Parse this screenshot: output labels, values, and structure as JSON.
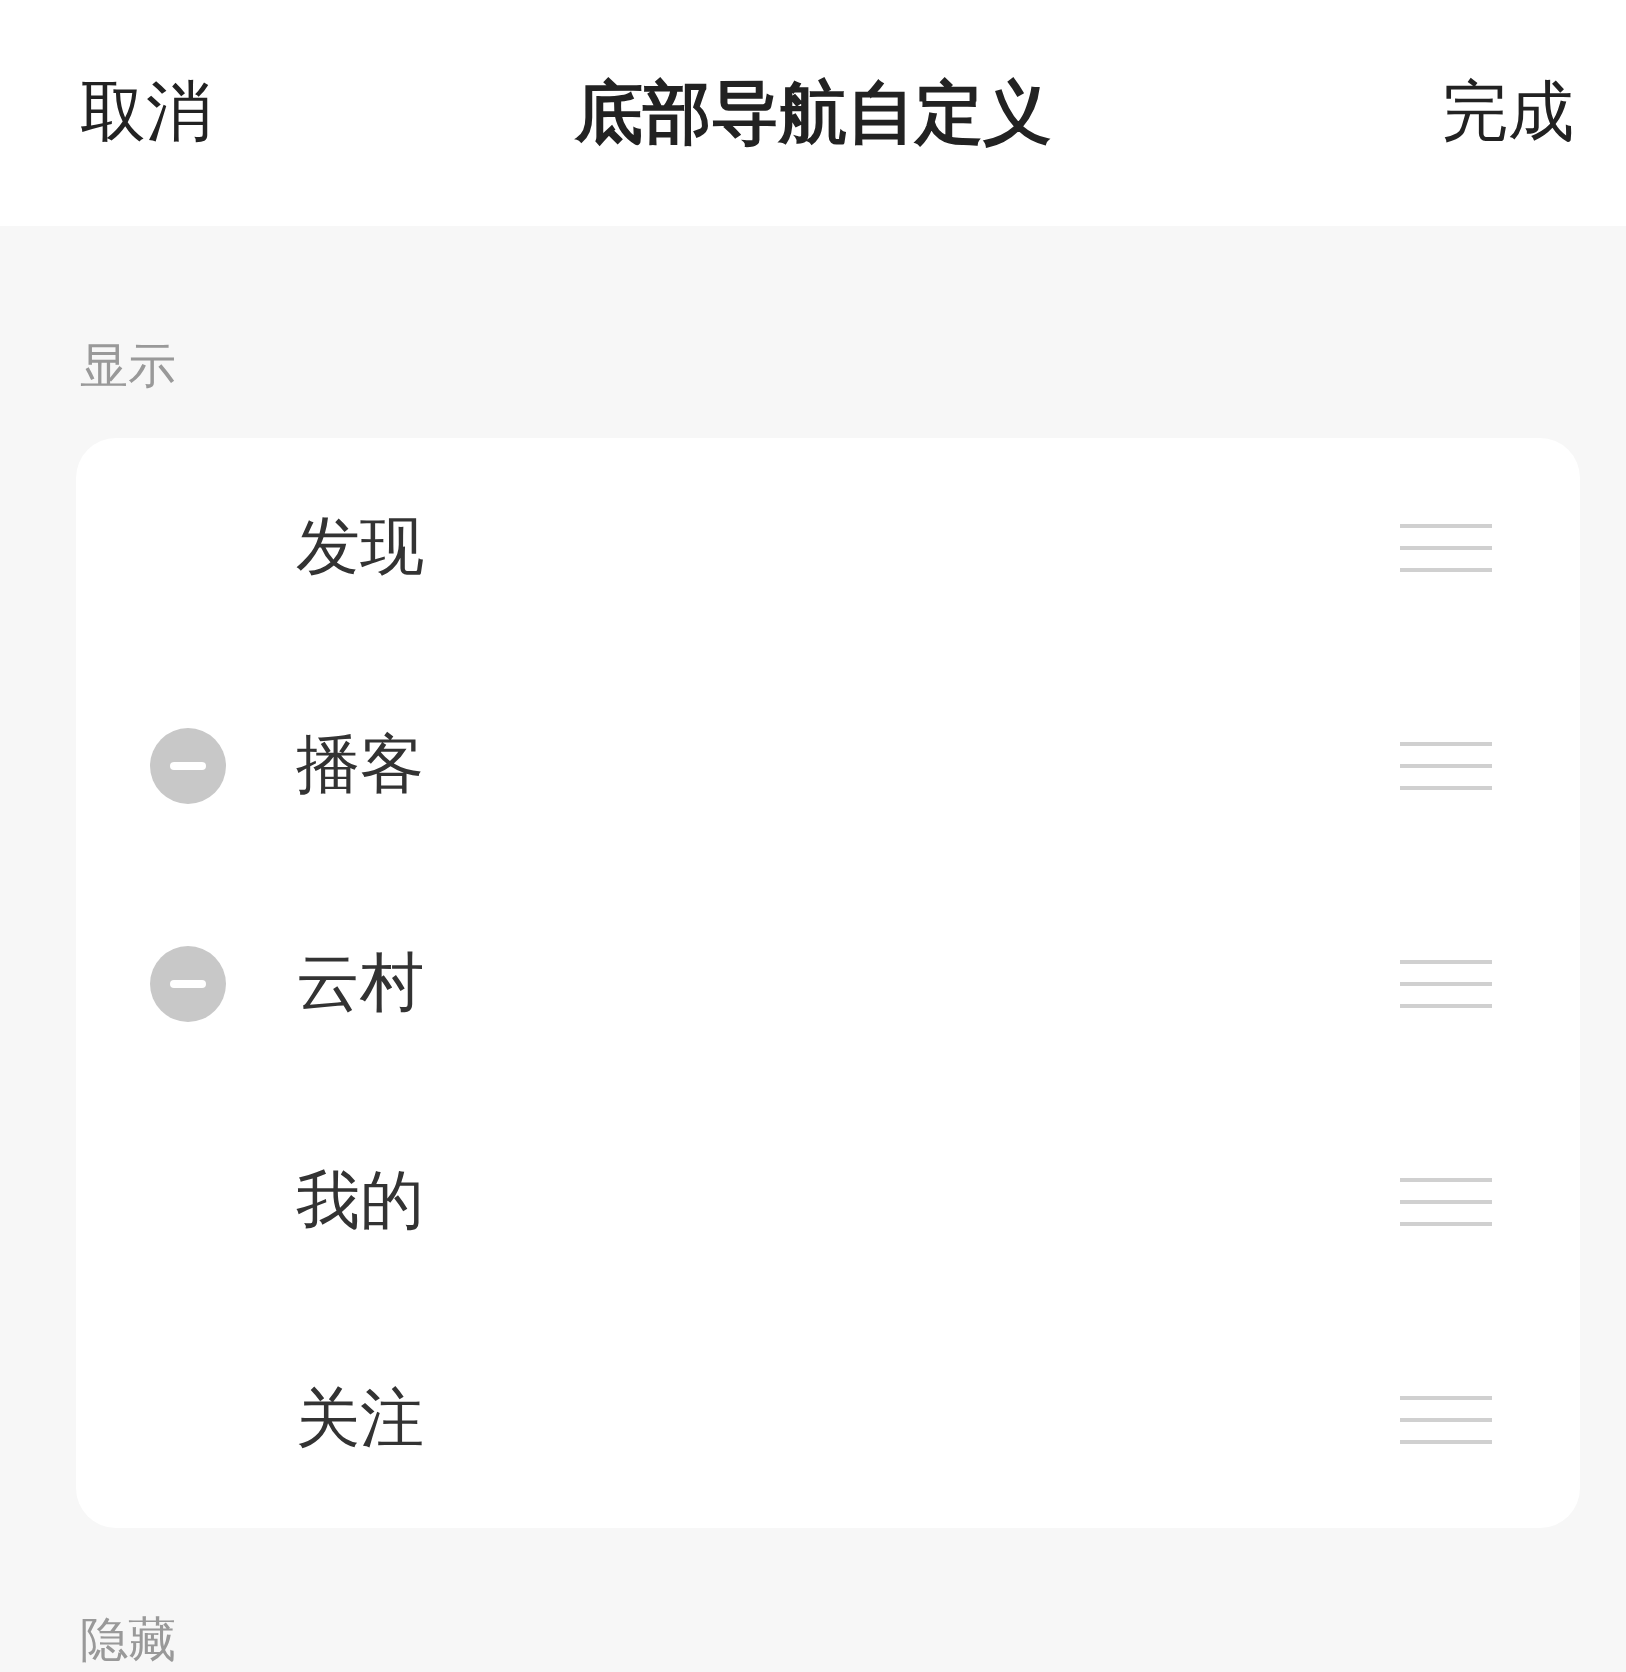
{
  "header": {
    "cancel": "取消",
    "title": "底部导航自定义",
    "done": "完成"
  },
  "shown_section": {
    "label": "显示",
    "items": [
      {
        "label": "发现",
        "removable": false
      },
      {
        "label": "播客",
        "removable": true
      },
      {
        "label": "云村",
        "removable": true
      },
      {
        "label": "我的",
        "removable": false
      },
      {
        "label": "关注",
        "removable": false
      }
    ]
  },
  "hidden_section": {
    "label": "隐藏"
  }
}
